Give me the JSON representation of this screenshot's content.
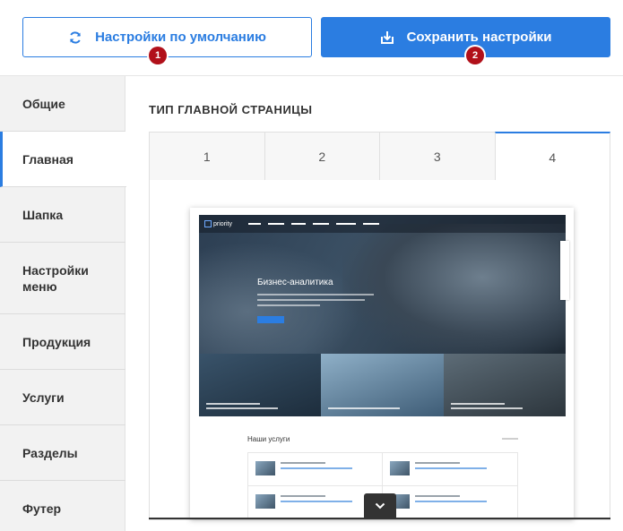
{
  "toolbar": {
    "default_label": "Настройки по умолчанию",
    "save_label": "Сохранить настройки",
    "badge1": "1",
    "badge2": "2"
  },
  "sidebar": {
    "items": [
      {
        "label": "Общие"
      },
      {
        "label": "Главная"
      },
      {
        "label": "Шапка"
      },
      {
        "label": "Настройки меню"
      },
      {
        "label": "Продукция"
      },
      {
        "label": "Услуги"
      },
      {
        "label": "Разделы"
      },
      {
        "label": "Футер"
      }
    ],
    "active_index": 1
  },
  "main": {
    "section_title": "ТИП ГЛАВНОЙ СТРАНИЦЫ",
    "tabs": [
      {
        "label": "1"
      },
      {
        "label": "2"
      },
      {
        "label": "3"
      },
      {
        "label": "4"
      }
    ],
    "active_tab": 3
  },
  "preview": {
    "logo_text": "priority",
    "hero_title": "Бизнес-аналитика",
    "services_title": "Наши услуги"
  },
  "colors": {
    "accent": "#2b7de1",
    "badge": "#b1101a"
  }
}
